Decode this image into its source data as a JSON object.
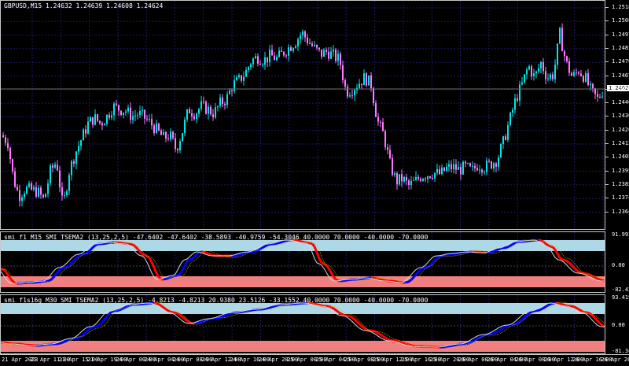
{
  "chart": {
    "symbol_header": "GBPUSD,M15  1.24632 1.24639 1.24608 1.24624",
    "current_price": "1.24624",
    "price_labels": [
      "1.25185",
      "1.25080",
      "1.24975",
      "1.24870",
      "1.24765",
      "1.24670",
      "1.24565",
      "1.24465",
      "1.24360",
      "1.24260",
      "1.24150",
      "1.24050",
      "1.23950",
      "1.23850",
      "1.23745",
      "1.23640"
    ],
    "time_labels": [
      "21 Apr 2023",
      "21 Apr 11:00",
      "21 Apr 15:00",
      "21 Apr 19:00",
      "24 Apr 00:00",
      "24 Apr 04:00",
      "24 Apr 08:00",
      "24 Apr 12:00",
      "24 Apr 16:00",
      "24 Apr 20:00",
      "25 Apr 00:00",
      "25 Apr 04:00",
      "25 Apr 08:00",
      "25 Apr 12:00",
      "25 Apr 16:00",
      "25 Apr 20:00",
      "26 Apr 00:00",
      "26 Apr 04:00",
      "26 Apr 08:00",
      "26 Apr 12:00",
      "26 Apr 16:00",
      "26 Apr 20:00"
    ],
    "bull_color": "#00e5e5",
    "bear_color": "#ff77ff",
    "grid_color": "#1a1a66"
  },
  "chart_data": {
    "type": "candlestick",
    "title": "GBPUSD,M15",
    "ylim": [
      1.2364,
      1.2523
    ],
    "close_path": [
      [
        0,
        1.243
      ],
      [
        8,
        1.2425
      ],
      [
        15,
        1.24
      ],
      [
        22,
        1.2388
      ],
      [
        30,
        1.2393
      ],
      [
        38,
        1.2392
      ],
      [
        46,
        1.2391
      ],
      [
        54,
        1.2385
      ],
      [
        62,
        1.2405
      ],
      [
        70,
        1.2412
      ],
      [
        78,
        1.238
      ],
      [
        86,
        1.2405
      ],
      [
        94,
        1.2418
      ],
      [
        102,
        1.2428
      ],
      [
        110,
        1.2438
      ],
      [
        118,
        1.2442
      ],
      [
        126,
        1.2438
      ],
      [
        134,
        1.2443
      ],
      [
        142,
        1.245
      ],
      [
        150,
        1.2448
      ],
      [
        158,
        1.2447
      ],
      [
        166,
        1.2443
      ],
      [
        174,
        1.2445
      ],
      [
        182,
        1.2442
      ],
      [
        190,
        1.2438
      ],
      [
        198,
        1.2433
      ],
      [
        206,
        1.2428
      ],
      [
        214,
        1.243
      ],
      [
        222,
        1.242
      ],
      [
        230,
        1.2433
      ],
      [
        238,
        1.2448
      ],
      [
        246,
        1.2445
      ],
      [
        254,
        1.245
      ],
      [
        262,
        1.2448
      ],
      [
        270,
        1.2445
      ],
      [
        278,
        1.2452
      ],
      [
        286,
        1.2455
      ],
      [
        294,
        1.2465
      ],
      [
        302,
        1.2468
      ],
      [
        310,
        1.2473
      ],
      [
        318,
        1.2482
      ],
      [
        326,
        1.2484
      ],
      [
        334,
        1.2482
      ],
      [
        342,
        1.2485
      ],
      [
        350,
        1.2483
      ],
      [
        358,
        1.2487
      ],
      [
        366,
        1.2491
      ],
      [
        374,
        1.2495
      ],
      [
        382,
        1.2501
      ],
      [
        390,
        1.2495
      ],
      [
        398,
        1.249
      ],
      [
        406,
        1.2486
      ],
      [
        414,
        1.2488
      ],
      [
        422,
        1.2485
      ],
      [
        430,
        1.2482
      ],
      [
        438,
        1.246
      ],
      [
        446,
        1.2462
      ],
      [
        454,
        1.2466
      ],
      [
        462,
        1.247
      ],
      [
        470,
        1.2465
      ],
      [
        478,
        1.244
      ],
      [
        486,
        1.243
      ],
      [
        494,
        1.241
      ],
      [
        502,
        1.2398
      ],
      [
        510,
        1.24
      ],
      [
        518,
        1.2395
      ],
      [
        526,
        1.2398
      ],
      [
        534,
        1.2402
      ],
      [
        542,
        1.2403
      ],
      [
        550,
        1.2404
      ],
      [
        558,
        1.2403
      ],
      [
        566,
        1.2407
      ],
      [
        574,
        1.2408
      ],
      [
        582,
        1.2406
      ],
      [
        590,
        1.2408
      ],
      [
        598,
        1.2405
      ],
      [
        606,
        1.241
      ],
      [
        614,
        1.2408
      ],
      [
        622,
        1.241
      ],
      [
        630,
        1.2413
      ],
      [
        638,
        1.2425
      ],
      [
        646,
        1.244
      ],
      [
        654,
        1.2455
      ],
      [
        662,
        1.2465
      ],
      [
        670,
        1.2478
      ],
      [
        678,
        1.247
      ],
      [
        686,
        1.248
      ],
      [
        694,
        1.247
      ],
      [
        702,
        1.2472
      ],
      [
        710,
        1.25
      ],
      [
        718,
        1.248
      ],
      [
        726,
        1.247
      ],
      [
        734,
        1.2475
      ],
      [
        742,
        1.247
      ],
      [
        750,
        1.246
      ],
      [
        758,
        1.2455
      ],
      [
        766,
        1.2462
      ]
    ],
    "ind1_ylim": [
      -82.4206,
      91.993
    ],
    "ind2_ylim": [
      -81.3458,
      93.4194
    ]
  },
  "ind1": {
    "title": "smi f1 M15 SMI TSEMA2 (13,25,2,5) -47.6402 -47.6402 -38.5893 -40.9759 -54.3046 40.0000 70.0000 -40.0000 -70.0000",
    "top_label": "91.993",
    "mid_label": "0.00",
    "bottom_label": "-82.4206"
  },
  "ind2": {
    "title": "smi f1s16g M30 SMI TSEMA2 (13,25,2,5) -4.8213 -4.8213 20.9380 23.5126 -33.1552 40.0000 70.0000 -40.0000 -70.0000",
    "top_label": "93.4194",
    "mid_label": "0.00",
    "bottom_label": "-81.3458"
  }
}
